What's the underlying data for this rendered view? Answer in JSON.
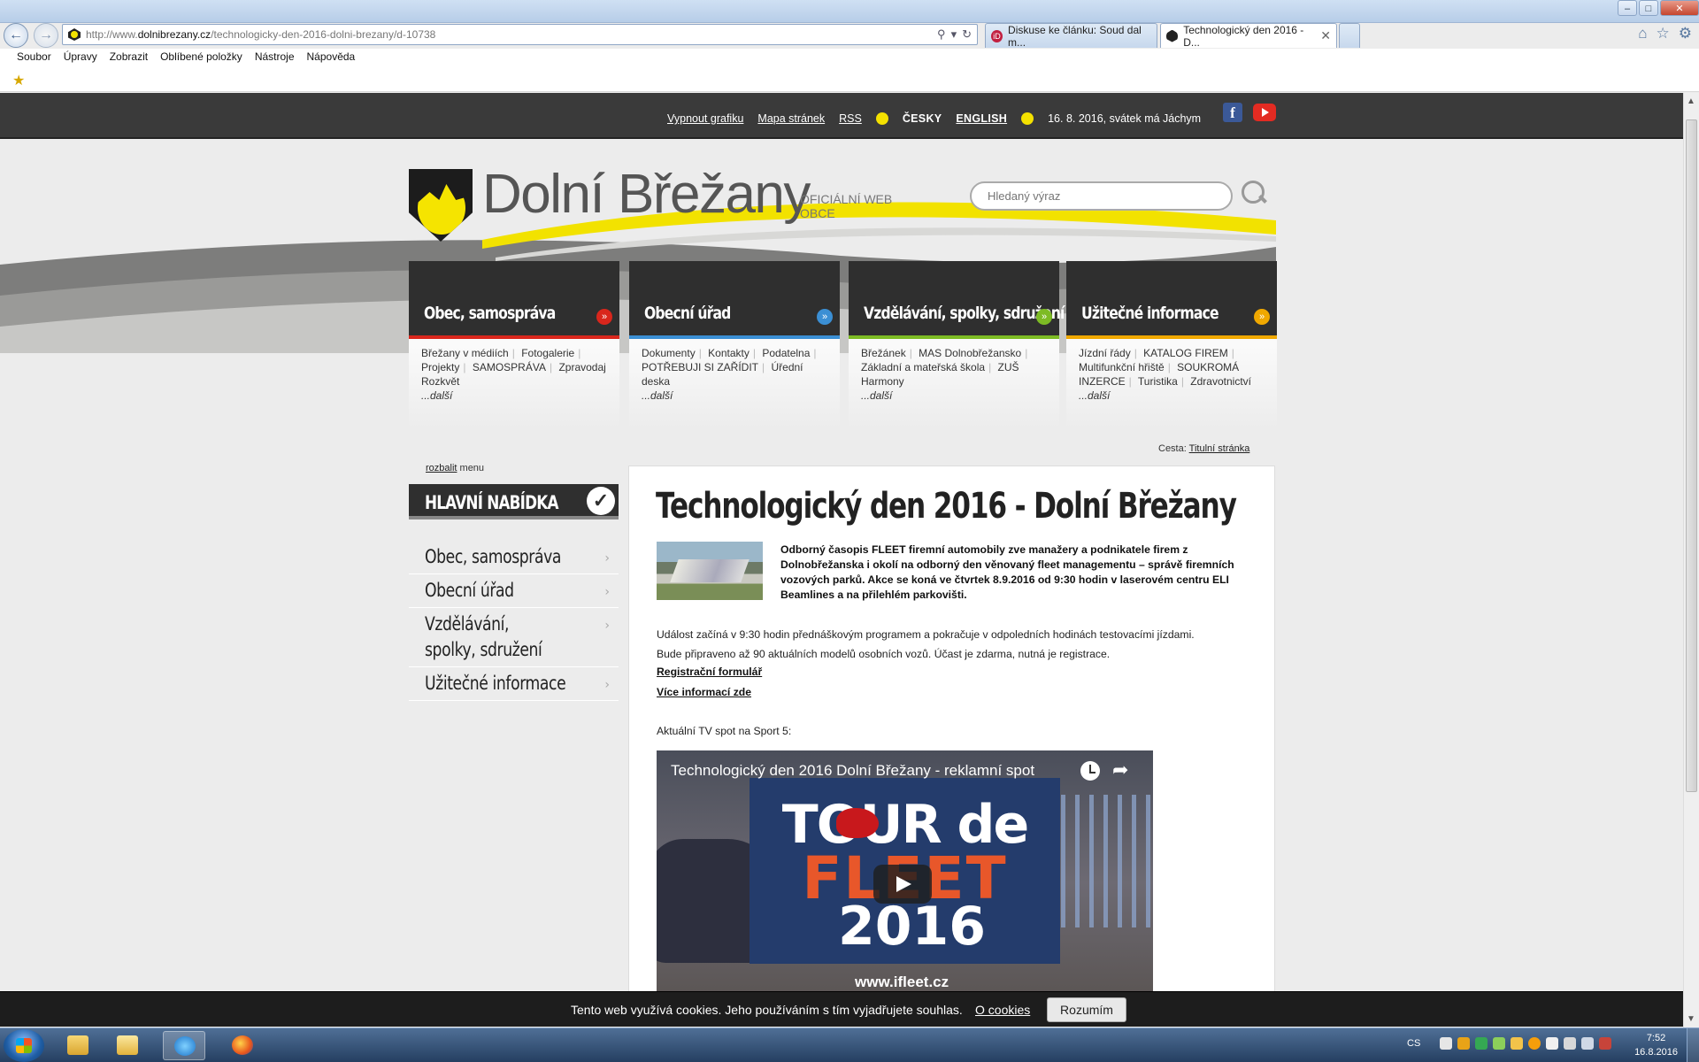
{
  "browser": {
    "url_prefix": "http://www.",
    "url_domain": "dolnibrezany.cz",
    "url_path": "/technologicky-den-2016-dolni-brezany/d-10738",
    "tabs": [
      {
        "label": "Diskuse ke článku: Soud dal m...",
        "active": false
      },
      {
        "label": "Technologický den 2016 - D...",
        "active": true
      }
    ],
    "menu": [
      "Soubor",
      "Úpravy",
      "Zobrazit",
      "Oblíbené položky",
      "Nástroje",
      "Nápověda"
    ]
  },
  "topstrip": {
    "links": [
      "Vypnout grafiku",
      "Mapa stránek",
      "RSS"
    ],
    "lang_cz": "ČESKY",
    "lang_en": "ENGLISH",
    "date_text": "16. 8. 2016, svátek má Jáchym"
  },
  "header": {
    "site_title": "Dolní Břežany",
    "site_sub_1": "Oficiální web",
    "site_sub_2": "obce",
    "search_placeholder": "Hledaný výraz"
  },
  "menu_boxes": [
    {
      "title": "Obec, samospráva",
      "color": "#d9261c",
      "links": [
        "Břežany v médiích",
        "Fotogalerie",
        "Projekty",
        "SAMOSPRÁVA",
        "Zpravodaj Rozkvět"
      ],
      "more": "...další"
    },
    {
      "title": "Obecní úřad",
      "color": "#3b8fd4",
      "links": [
        "Dokumenty",
        "Kontakty",
        "Podatelna",
        "POTŘEBUJI SI ZAŘÍDIT",
        "Úřední deska"
      ],
      "more": "...další"
    },
    {
      "title": "Vzdělávání, spolky, sdružení",
      "color": "#7dbb24",
      "links": [
        "Břežánek",
        "MAS Dolnobřežansko",
        "Základní a mateřská škola",
        "ZUŠ Harmony"
      ],
      "more": "...další"
    },
    {
      "title": "Užitečné informace",
      "color": "#f0a800",
      "links": [
        "Jízdní řády",
        "KATALOG FIREM",
        "Multifunkční hřiště",
        "SOUKROMÁ INZERCE",
        "Turistika",
        "Zdravotnictví"
      ],
      "more": "...další"
    }
  ],
  "breadcrumb": {
    "label": "Cesta:",
    "link": "Titulní stránka"
  },
  "sidebar": {
    "expand_link": "rozbalit",
    "expand_rest": "menu",
    "heading": "HLAVNÍ NABÍDKA",
    "items": [
      "Obec, samospráva",
      "Obecní úřad",
      "Vzdělávání, spolky, sdružení",
      "Užitečné informace"
    ]
  },
  "article": {
    "title": "Technologický den 2016 - Dolní Břežany",
    "lead": "Odborný časopis FLEET firemní automobily zve manažery a podnikatele firem z Dolnobřežanska i okolí na odborný den věnovaný fleet managementu – správě firemních vozových parků. Akce se koná ve čtvrtek 8.9.2016 od 9:30 hodin v laserovém centru ELI Beamlines a na přilehlém parkovišti.",
    "para_1": "Událost začíná v 9:30 hodin přednáškovým programem a pokračuje v odpoledních hodinách testovacími jízdami.",
    "para_2": "Bude připraveno až 90 aktuálních modelů osobních vozů. Účast je zdarma, nutná je registrace.",
    "reg_link": "Registrační formulář",
    "more_link": "Více informací zde",
    "tv_spot": "Aktuální TV spot na Sport 5:",
    "video": {
      "title": "Technologický den 2016 Dolní Břežany - reklamní spot",
      "poster_line1": "TOUR de",
      "poster_line2": "FLEET",
      "poster_line3": "2016",
      "url": "www.ifleet.cz"
    }
  },
  "cookie": {
    "text": "Tento web využívá cookies. Jeho používáním s tím vyjadřujete souhlas.",
    "link": "O cookies",
    "button": "Rozumím"
  },
  "taskbar": {
    "lang": "CS",
    "time": "7:52",
    "date": "16.8.2016"
  }
}
